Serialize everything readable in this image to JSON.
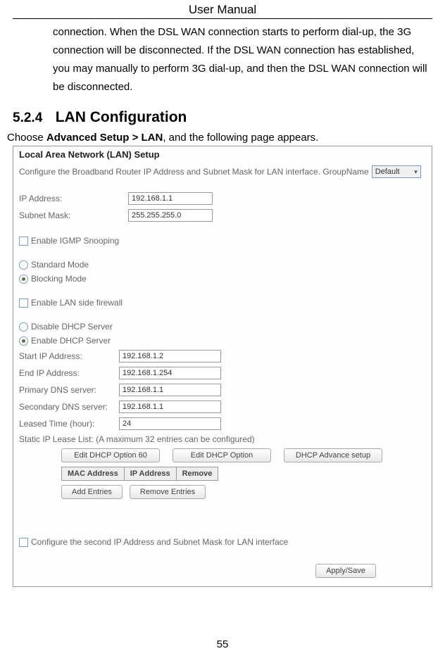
{
  "header": {
    "title": "User Manual"
  },
  "paragraph": "connection. When the DSL WAN connection starts to perform dial-up, the 3G connection will be disconnected. If the DSL WAN connection has established, you may manually to perform 3G dial-up, and then the DSL WAN connection will be disconnected.",
  "section": {
    "number": "5.2.4",
    "title": "LAN Configuration"
  },
  "instruction": {
    "prefix": "Choose ",
    "bold": "Advanced Setup > LAN",
    "suffix": ", and the following page appears."
  },
  "lan": {
    "heading": "Local Area Network (LAN) Setup",
    "configure_text": "Configure the Broadband Router IP Address and Subnet Mask for LAN interface. GroupName",
    "group_name_value": "Default",
    "ip_label": "IP Address:",
    "ip_value": "192.168.1.1",
    "subnet_label": "Subnet Mask:",
    "subnet_value": "255.255.255.0",
    "igmp_label": "Enable IGMP Snooping",
    "standard_label": "Standard Mode",
    "blocking_label": "Blocking Mode",
    "firewall_label": "Enable LAN side firewall",
    "disable_dhcp_label": "Disable DHCP Server",
    "enable_dhcp_label": "Enable DHCP Server",
    "start_ip_label": "Start IP Address:",
    "start_ip_value": "192.168.1.2",
    "end_ip_label": "End IP Address:",
    "end_ip_value": "192.168.1.254",
    "primary_dns_label": "Primary DNS server:",
    "primary_dns_value": "192.168.1.1",
    "secondary_dns_label": "Secondary DNS server:",
    "secondary_dns_value": "192.168.1.1",
    "leased_label": "Leased Time (hour):",
    "leased_value": "24",
    "static_lease_text": "Static IP Lease List: (A maximum 32 entries can be configured)",
    "btn_edit60": "Edit DHCP Option 60",
    "btn_edit": "Edit DHCP Option",
    "btn_advance": "DHCP Advance setup",
    "th_mac": "MAC Address",
    "th_ip": "IP Address",
    "th_remove": "Remove",
    "btn_add": "Add Entries",
    "btn_remove": "Remove Entries",
    "second_ip_label": "Configure the second IP Address and Subnet Mask for LAN interface",
    "btn_apply": "Apply/Save"
  },
  "page_number": "55"
}
